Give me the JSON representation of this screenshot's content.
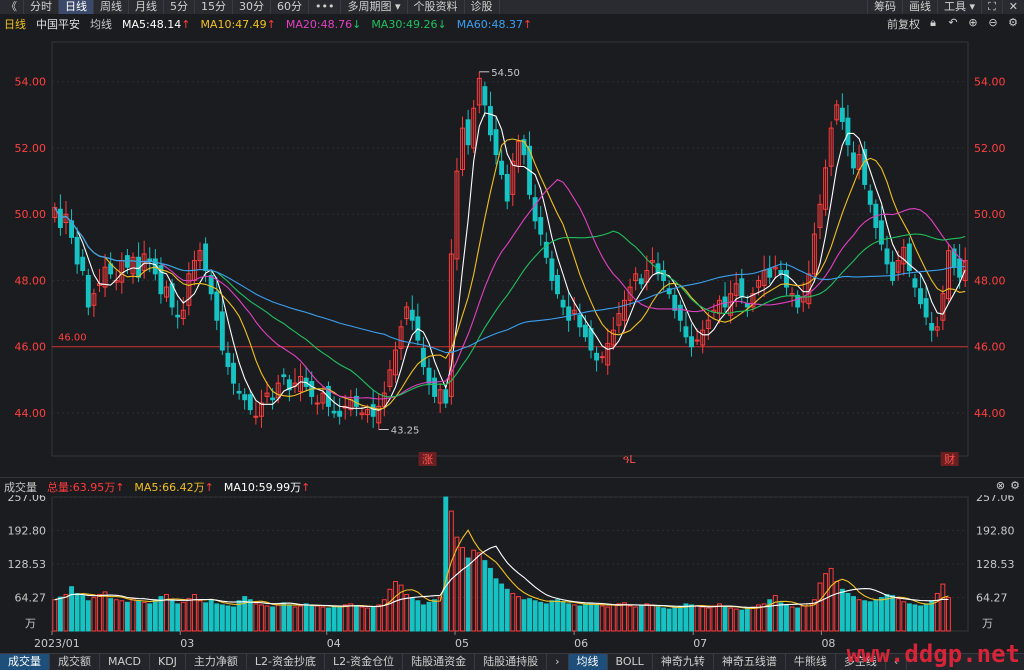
{
  "toolbar": {
    "left_arrow": "《",
    "periods": [
      "分时",
      "日线",
      "周线",
      "月线",
      "5分",
      "15分",
      "30分",
      "60分",
      "•••",
      "多周期图 ▾",
      "个股资料",
      "诊股"
    ],
    "active_index": 1,
    "right": [
      "筹码",
      "画线",
      "工具 ▾"
    ],
    "right_icons": [
      "⛶",
      "✕"
    ]
  },
  "info": {
    "period": "日线",
    "stock": "中国平安",
    "ma_label": "均线",
    "ma5": "MA5:48.14",
    "ma10": "MA10:47.49",
    "ma20": "MA20:48.76",
    "ma30": "MA30:49.26",
    "ma60": "MA60:48.37",
    "adjust": "前复权"
  },
  "colors": {
    "up": "#ff3b3b",
    "down": "#16c2c2",
    "ma5": "#ffffff",
    "ma10": "#f0c020",
    "ma20": "#e040c0",
    "ma30": "#20c060",
    "ma60": "#3aa0f0",
    "axis_text": "#ff4040",
    "grid": "#2c2d33"
  },
  "volume": {
    "label": "成交量",
    "total": "总量:63.95万",
    "ma5": "MA5:66.42万",
    "ma10": "MA10:59.99万",
    "unit": "万"
  },
  "chart_data": {
    "type": "candlestick",
    "ylim": [
      42.7,
      55.2
    ],
    "price_ticks": [
      "54.00",
      "52.00",
      "50.00",
      "48.00",
      "46.00",
      "44.00"
    ],
    "ref_line": 46.0,
    "ref_label": "46.00",
    "high_label": "54.50",
    "low_label": "43.25",
    "vol_ticks": [
      "257.06",
      "192.80",
      "128.53",
      "64.27"
    ],
    "vol_max": 257.06,
    "x_labels": [
      "2023/01",
      "03",
      "04",
      "05",
      "06",
      "07",
      "08"
    ],
    "markers": [
      "涨",
      "ዓL",
      "财"
    ],
    "close": [
      50.2,
      49.6,
      50.0,
      49.3,
      48.5,
      48.3,
      47.2,
      47.6,
      47.9,
      48.4,
      48.2,
      48.0,
      48.6,
      48.4,
      48.7,
      48.1,
      48.8,
      48.6,
      48.2,
      47.6,
      47.8,
      47.2,
      46.9,
      47.1,
      48.2,
      48.6,
      48.9,
      48.3,
      47.6,
      46.8,
      45.9,
      45.4,
      44.9,
      44.6,
      44.4,
      44.1,
      43.9,
      44.3,
      44.6,
      44.4,
      44.9,
      45.1,
      44.7,
      44.9,
      45.1,
      44.8,
      44.5,
      44.3,
      44.6,
      44.2,
      44.0,
      43.9,
      44.2,
      44.4,
      44.2,
      44.0,
      44.1,
      43.9,
      44.2,
      44.6,
      45.3,
      45.9,
      46.6,
      47.2,
      46.8,
      46.2,
      45.4,
      44.9,
      44.5,
      44.7,
      44.3,
      48.8,
      51.3,
      52.6,
      52.1,
      53.2,
      54.1,
      53.3,
      52.4,
      51.8,
      51.2,
      50.4,
      51.6,
      52.2,
      51.8,
      50.6,
      49.8,
      49.4,
      48.7,
      48.0,
      47.6,
      47.2,
      46.8,
      47.1,
      46.6,
      46.3,
      45.9,
      45.6,
      45.7,
      46.1,
      46.5,
      47.0,
      47.4,
      47.8,
      48.2,
      47.9,
      48.3,
      48.6,
      48.2,
      48.0,
      47.6,
      47.1,
      46.8,
      46.3,
      46.0,
      46.2,
      46.5,
      46.8,
      47.1,
      47.4,
      47.2,
      47.6,
      47.9,
      47.5,
      47.2,
      47.6,
      48.0,
      48.3,
      48.1,
      48.4,
      48.2,
      47.8,
      47.6,
      47.2,
      47.5,
      48.2,
      49.4,
      50.3,
      51.4,
      52.6,
      53.3,
      52.8,
      52.1,
      51.4,
      51.8,
      50.9,
      50.3,
      49.6,
      49.1,
      48.5,
      48.0,
      48.6,
      49.0,
      48.3,
      47.8,
      47.3,
      46.9,
      46.5,
      46.6,
      47.6,
      48.9,
      48.4,
      48.1,
      48.6
    ],
    "volume": [
      60,
      65,
      70,
      85,
      72,
      68,
      58,
      64,
      70,
      75,
      62,
      60,
      58,
      55,
      62,
      58,
      55,
      52,
      60,
      66,
      70,
      58,
      52,
      55,
      62,
      70,
      58,
      54,
      60,
      52,
      50,
      48,
      46,
      58,
      66,
      60,
      52,
      50,
      48,
      46,
      52,
      54,
      50,
      46,
      48,
      52,
      50,
      48,
      46,
      44,
      46,
      48,
      50,
      52,
      48,
      46,
      44,
      46,
      50,
      60,
      80,
      95,
      88,
      70,
      62,
      58,
      50,
      55,
      60,
      65,
      257,
      230,
      180,
      160,
      140,
      155,
      150,
      135,
      120,
      100,
      90,
      80,
      72,
      66,
      60,
      62,
      58,
      55,
      52,
      58,
      60,
      56,
      52,
      50,
      48,
      52,
      54,
      50,
      48,
      46,
      50,
      52,
      54,
      48,
      46,
      48,
      52,
      50,
      46,
      44,
      42,
      45,
      48,
      52,
      50,
      48,
      46,
      44,
      48,
      52,
      46,
      44,
      42,
      40,
      44,
      46,
      50,
      52,
      60,
      68,
      54,
      50,
      46,
      44,
      48,
      52,
      60,
      92,
      110,
      120,
      95,
      80,
      72,
      66,
      60,
      58,
      56,
      60,
      64,
      70,
      68,
      62,
      56,
      52,
      50,
      48,
      52,
      58,
      72,
      90,
      64
    ]
  },
  "bottom_tabs": [
    "成交量",
    "成交额",
    "MACD",
    "KDJ",
    "主力净额",
    "L2-资金抄底",
    "L2-资金仓位",
    "陆股通资金",
    "陆股通持股",
    "›",
    "均线",
    "BOLL",
    "神奇九转",
    "神奇五线谱",
    "牛熊线",
    "多空线",
    "‹"
  ],
  "bottom_active": [
    0,
    10
  ],
  "watermark": "www.ddgp.net"
}
